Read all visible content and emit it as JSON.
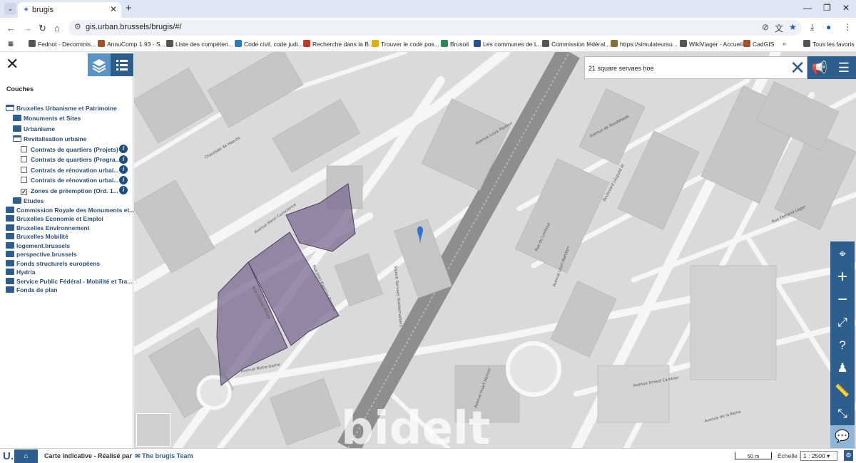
{
  "browser": {
    "tab_title": "brugis",
    "url": "gis.urban.brussels/brugis/#/",
    "bookmarks": [
      {
        "label": "Fednot - Decommis...",
        "color": "#555555"
      },
      {
        "label": "AnnuComp 1.93 - S...",
        "color": "#a0522d"
      },
      {
        "label": "Liste des compéten...",
        "color": "#555555"
      },
      {
        "label": "Code civil, code judi...",
        "color": "#2a7dc1"
      },
      {
        "label": "Recherche dans la B...",
        "color": "#c0392b"
      },
      {
        "label": "Trouver le code pos...",
        "color": "#e0b000"
      },
      {
        "label": "Brusoil",
        "color": "#2e8b57"
      },
      {
        "label": "Les communes de L...",
        "color": "#2a4d9a"
      },
      {
        "label": "Commission fédéral...",
        "color": "#555555"
      },
      {
        "label": "https://simulateursu...",
        "color": "#8a6d3b"
      },
      {
        "label": "WikiViager - Accueil",
        "color": "#555555"
      },
      {
        "label": "CadGIS",
        "color": "#a0522d"
      },
      {
        "label": "Tous les favoris",
        "color": "#555555"
      }
    ]
  },
  "panel": {
    "heading": "Couches",
    "tree": [
      {
        "label": "Bruxelles Urbanisme et Patrimoine",
        "level": 0,
        "kind": "folder-open"
      },
      {
        "label": "Monuments et Sites",
        "level": 1,
        "kind": "folder"
      },
      {
        "label": "Urbanisme",
        "level": 1,
        "kind": "folder"
      },
      {
        "label": "Revitalisation urbaine",
        "level": 1,
        "kind": "folder-open"
      },
      {
        "label": "Contrats de quartiers (Projets)",
        "level": 2,
        "kind": "checkbox",
        "checked": false
      },
      {
        "label": "Contrats de quartiers (Progra...",
        "level": 2,
        "kind": "checkbox",
        "checked": false
      },
      {
        "label": "Contrats de rénovation urbai...",
        "level": 2,
        "kind": "checkbox",
        "checked": false
      },
      {
        "label": "Contrats de rénovation urbai...",
        "level": 2,
        "kind": "checkbox",
        "checked": false
      },
      {
        "label": "Zones de préemption (Ord. 1...",
        "level": 2,
        "kind": "checkbox",
        "checked": true
      },
      {
        "label": "Etudes",
        "level": 1,
        "kind": "folder"
      },
      {
        "label": "Commission Royale des Monuments et...",
        "level": 0,
        "kind": "folder"
      },
      {
        "label": "Bruxelles Economie et Emploi",
        "level": 0,
        "kind": "folder"
      },
      {
        "label": "Bruxelles Environnement",
        "level": 0,
        "kind": "folder"
      },
      {
        "label": "Bruxelles Mobilité",
        "level": 0,
        "kind": "folder"
      },
      {
        "label": "logement.brussels",
        "level": 0,
        "kind": "folder"
      },
      {
        "label": "perspective.brussels",
        "level": 0,
        "kind": "folder"
      },
      {
        "label": "Fonds structurels européens",
        "level": 0,
        "kind": "folder"
      },
      {
        "label": "Hydria",
        "level": 0,
        "kind": "folder"
      },
      {
        "label": "Service Public Fédéral - Mobilité et Tra...",
        "level": 0,
        "kind": "folder"
      },
      {
        "label": "Fonds de plan",
        "level": 0,
        "kind": "folder"
      }
    ]
  },
  "map": {
    "search_value": "21 square servaes hoe",
    "watermark": "bidelt",
    "streets": [
      "Avenue Henri Conscience",
      "Rue Jean-Baptiste Desmet",
      "Square Servaes Hoedemaekers",
      "Avenue Notre-Dame",
      "Rue Colonel Bourg",
      "Avenue de Roodebeek",
      "Rue du Linthout",
      "Avenue Louis Pasteur",
      "Avenue Léon Mahillon",
      "Avenue Ernest Cambier",
      "Avenue Huart Hamoir",
      "Chaussée de Haecht",
      "Avenue de la Reine",
      "Rue Fernand Léger",
      "Boulevard Léopold III"
    ]
  },
  "footer": {
    "text": "Carte indicative - Réalisé par",
    "team": "The brugis Team",
    "scale_bar": "50 m",
    "scale_label": "Échelle :",
    "scale_value": "1 : 2500"
  },
  "colors": {
    "accent_dark": "#2d5e8e",
    "accent_light": "#5a94c6",
    "preemption_zone": "#7b6a8f"
  }
}
